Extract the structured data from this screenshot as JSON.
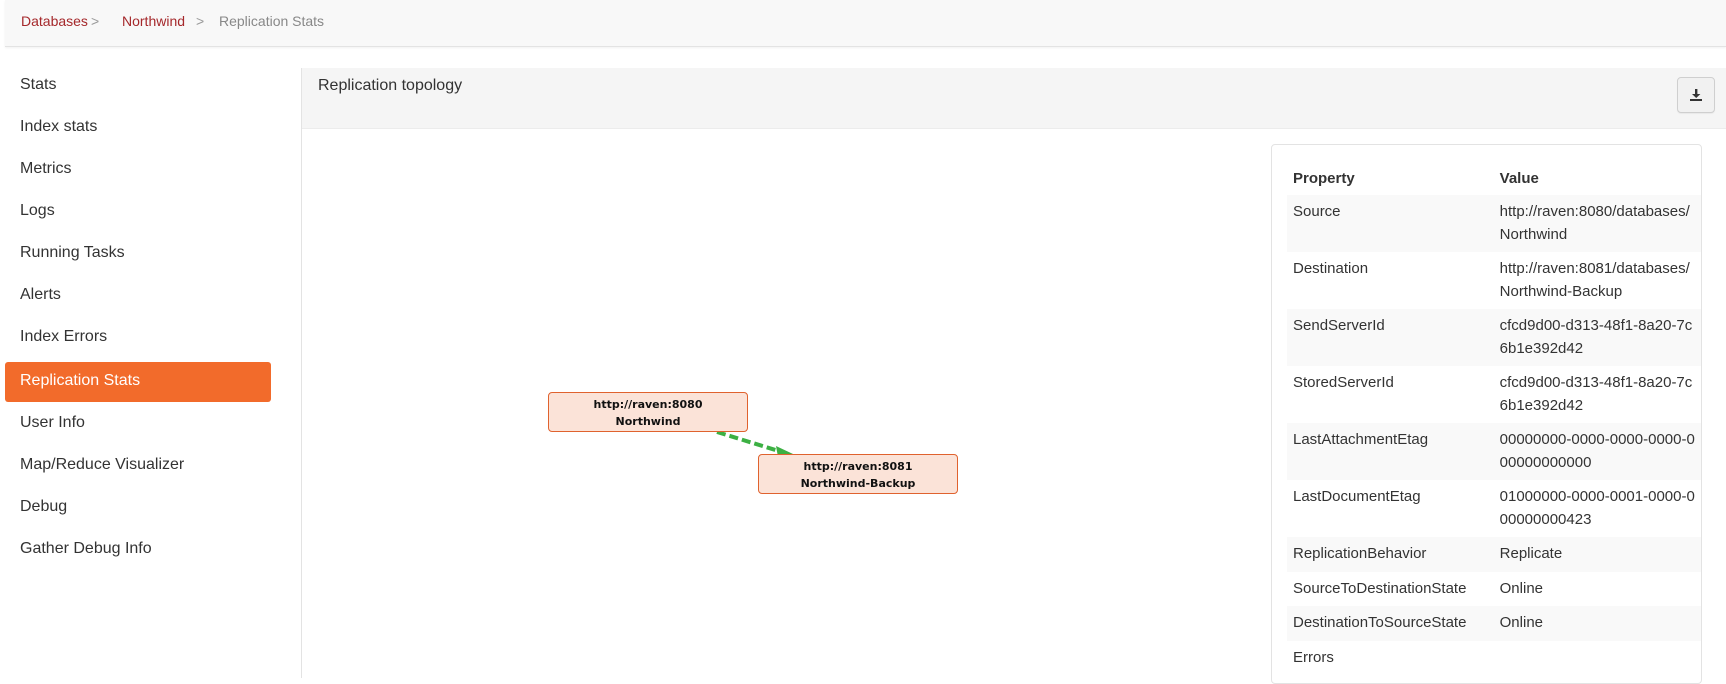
{
  "breadcrumb": {
    "items": [
      "Databases",
      "Northwind"
    ],
    "separator": ">",
    "current": "Replication Stats"
  },
  "sidebar": {
    "items": [
      {
        "label": "Stats"
      },
      {
        "label": "Index stats"
      },
      {
        "label": "Metrics"
      },
      {
        "label": "Logs"
      },
      {
        "label": "Running Tasks"
      },
      {
        "label": "Alerts"
      },
      {
        "label": "Index Errors"
      },
      {
        "label": "Replication Stats",
        "active": true
      },
      {
        "label": "User Info"
      },
      {
        "label": "Map/Reduce Visualizer"
      },
      {
        "label": "Debug"
      },
      {
        "label": "Gather Debug Info"
      }
    ]
  },
  "panel": {
    "title": "Replication topology",
    "download_icon": "download-icon"
  },
  "topology": {
    "nodes": [
      {
        "url": "http://raven:8080",
        "name": "Northwind"
      },
      {
        "url": "http://raven:8081",
        "name": "Northwind-Backup"
      }
    ],
    "edge_color": "#3cb043"
  },
  "properties": {
    "headers": [
      "Property",
      "Value"
    ],
    "rows": [
      {
        "key": "Source",
        "value": "http://raven:8080/databases/Northwind"
      },
      {
        "key": "Destination",
        "value": "http://raven:8081/databases/Northwind-Backup"
      },
      {
        "key": "SendServerId",
        "value": "cfcd9d00-d313-48f1-8a20-7c6b1e392d42"
      },
      {
        "key": "StoredServerId",
        "value": "cfcd9d00-d313-48f1-8a20-7c6b1e392d42"
      },
      {
        "key": "LastAttachmentEtag",
        "value": "00000000-0000-0000-0000-000000000000"
      },
      {
        "key": "LastDocumentEtag",
        "value": "01000000-0000-0001-0000-000000000423"
      },
      {
        "key": "ReplicationBehavior",
        "value": "Replicate"
      },
      {
        "key": "SourceToDestinationState",
        "value": "Online"
      },
      {
        "key": "DestinationToSourceState",
        "value": "Online"
      },
      {
        "key": "Errors",
        "value": ""
      }
    ]
  },
  "colors": {
    "accent": "#f26b2b",
    "link": "#a5282b",
    "node_fill": "#fbe3d8",
    "node_border": "#e0622e"
  }
}
